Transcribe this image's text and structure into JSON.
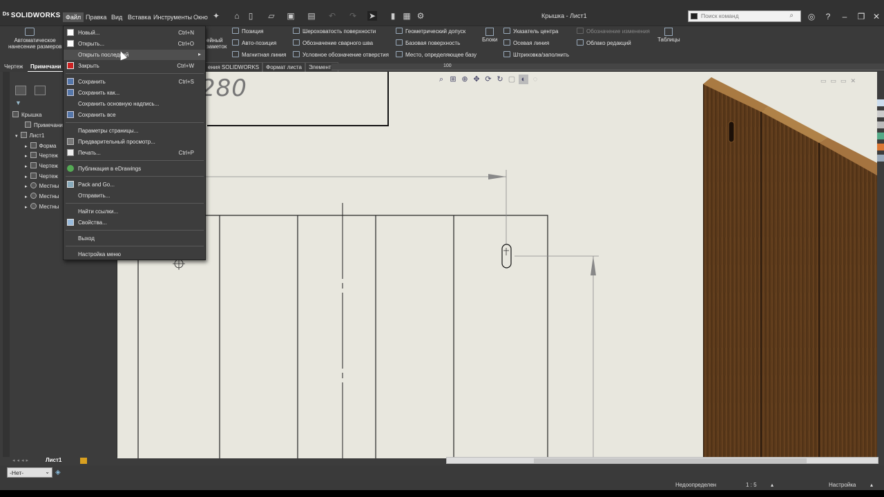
{
  "app": {
    "logo": "SOLIDWORKS",
    "window_title": "Крышка - Лист1",
    "search_placeholder": "Поиск команд"
  },
  "menubar": {
    "items": [
      "Файл",
      "Правка",
      "Вид",
      "Вставка",
      "Инструменты",
      "Окно"
    ],
    "active": "Файл"
  },
  "ribbon": {
    "auto_dimension": [
      "Автоматическое",
      "нанесение размеров"
    ],
    "note_fragment": [
      "ейный",
      "заметок"
    ],
    "col1": [
      "Позиция",
      "Авто-позиция",
      "Магнитная линия"
    ],
    "col2": [
      "Шероховатость поверхности",
      "Обозначение сварного шва",
      "Условное обозначение отверстия"
    ],
    "col3": [
      "Геометрический допуск",
      "Базовая поверхность",
      "Место, определяющее базу"
    ],
    "blocks": "Блоки",
    "col4": [
      "Указатель центра",
      "Осевая линия",
      "Штриховка/заполнить"
    ],
    "col5": [
      "Обозначение изменения",
      "Облако редакций"
    ],
    "tables": "Таблицы"
  },
  "tabs": {
    "left": [
      "Чертеж",
      "Примечани"
    ],
    "right": [
      "ения SOLIDWORKS",
      "Формат листа",
      "Элементы"
    ]
  },
  "ruler": {
    "mark": "100"
  },
  "tree": {
    "root": "Крышка",
    "items": [
      "Примечани",
      "Лист1",
      "Форма",
      "Чертеж",
      "Чертеж",
      "Чертеж",
      "Местны",
      "Местны",
      "Местны"
    ]
  },
  "drawing": {
    "dimension_text": "280"
  },
  "sheet_tab": "Лист1",
  "layer_select": {
    "value": "-Нет-"
  },
  "status": {
    "state": "Недоопределен",
    "scale": "1 : 5",
    "settings": "Настройка"
  },
  "file_menu": {
    "items": [
      {
        "label": "Новый...",
        "shortcut": "Ctrl+N",
        "icon": "new-doc-icon"
      },
      {
        "label": "Открыть...",
        "shortcut": "Ctrl+O",
        "icon": "open-icon"
      },
      {
        "label": "Открыть последний",
        "shortcut": "",
        "icon": "",
        "submenu": true,
        "hover": true
      },
      {
        "label": "Закрыть",
        "shortcut": "Ctrl+W",
        "icon": "close-doc-icon"
      },
      {
        "label": "Сохранить",
        "shortcut": "Ctrl+S",
        "icon": "save-icon"
      },
      {
        "label": "Сохранить как...",
        "shortcut": "",
        "icon": "save-as-icon"
      },
      {
        "label": "Сохранить основную надпись...",
        "shortcut": "",
        "icon": ""
      },
      {
        "label": "Сохранить все",
        "shortcut": "",
        "icon": "save-all-icon"
      },
      {
        "label": "Параметры страницы...",
        "shortcut": "",
        "icon": ""
      },
      {
        "label": "Предварительный просмотр...",
        "shortcut": "",
        "icon": "preview-icon"
      },
      {
        "label": "Печать...",
        "shortcut": "Ctrl+P",
        "icon": "print-icon"
      },
      {
        "label": "Публикация в eDrawings",
        "shortcut": "",
        "icon": "edrawings-icon"
      },
      {
        "label": "Pack and Go...",
        "shortcut": "",
        "icon": "pack-and-go-icon"
      },
      {
        "label": "Отправить...",
        "shortcut": "",
        "icon": ""
      },
      {
        "label": "Найти ссылки...",
        "shortcut": "",
        "icon": ""
      },
      {
        "label": "Свойства...",
        "shortcut": "",
        "icon": "properties-icon"
      },
      {
        "label": "Выход",
        "shortcut": "",
        "icon": ""
      },
      {
        "label": "Настройка меню",
        "shortcut": "",
        "icon": ""
      }
    ]
  },
  "colors": {
    "ui_dark": "#3a3a3a",
    "sheet": "#e8e7de",
    "wood": "#5a3a1c",
    "wood_edge": "#8a5a2a"
  }
}
